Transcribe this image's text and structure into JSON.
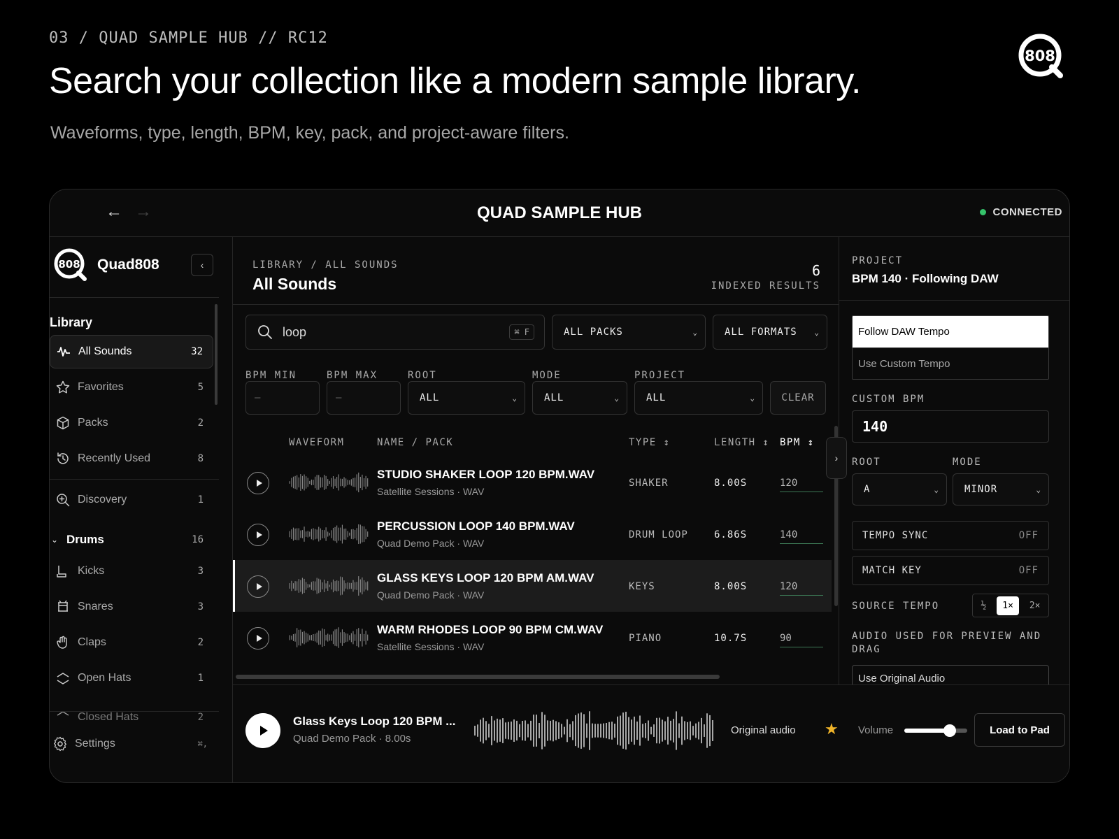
{
  "hero": {
    "eyebrow": "03 / QUAD SAMPLE HUB // RC12",
    "headline": "Search your collection like a modern sample library.",
    "subline": "Waveforms, type, length, BPM, key, pack, and project-aware filters.",
    "logo_text": "808"
  },
  "titlebar": {
    "title": "QUAD SAMPLE HUB",
    "back_icon": "←",
    "forward_icon": "→",
    "status": "CONNECTED",
    "status_color": "#36c36b"
  },
  "sidebar": {
    "brand": "Quad808",
    "logo_text": "808",
    "collapse_icon": "‹",
    "heading": "Library",
    "items": [
      {
        "label": "All Sounds",
        "count": "32",
        "icon": "waveform-icon"
      },
      {
        "label": "Favorites",
        "count": "5",
        "icon": "star-icon"
      },
      {
        "label": "Packs",
        "count": "2",
        "icon": "box-icon"
      },
      {
        "label": "Recently Used",
        "count": "8",
        "icon": "history-icon"
      },
      {
        "label": "Discovery",
        "count": "1",
        "icon": "zoom-icon"
      }
    ],
    "group": {
      "label": "Drums",
      "count": "16",
      "icon": "chevron-down-icon"
    },
    "drums": [
      {
        "label": "Kicks",
        "count": "3",
        "icon": "kick-icon"
      },
      {
        "label": "Snares",
        "count": "3",
        "icon": "snare-icon"
      },
      {
        "label": "Claps",
        "count": "2",
        "icon": "hand-icon"
      },
      {
        "label": "Open Hats",
        "count": "1",
        "icon": "open-hat-icon"
      },
      {
        "label": "Closed Hats",
        "count": "2",
        "icon": "closed-hat-icon"
      }
    ],
    "settings": {
      "label": "Settings",
      "shortcut": "⌘,",
      "icon": "gear-icon"
    }
  },
  "main": {
    "breadcrumb": "LIBRARY / ALL SOUNDS",
    "title": "All Sounds",
    "results_count": "6",
    "results_label": "INDEXED RESULTS",
    "search": {
      "value": "loop",
      "shortcut": "⌘ F"
    },
    "packs_select": "ALL PACKS",
    "formats_select": "ALL FORMATS",
    "filters": {
      "bpm_min_label": "BPM MIN",
      "bpm_min_placeholder": "—",
      "bpm_max_label": "BPM MAX",
      "bpm_max_placeholder": "—",
      "root_label": "ROOT",
      "root_value": "ALL",
      "mode_label": "MODE",
      "mode_value": "ALL",
      "project_label": "PROJECT",
      "project_value": "ALL",
      "clear_label": "CLEAR"
    },
    "columns": {
      "waveform": "WAVEFORM",
      "name": "NAME / PACK",
      "type": "TYPE ↕",
      "length": "LENGTH ↕",
      "bpm": "BPM ↕"
    },
    "rows": [
      {
        "name": "STUDIO SHAKER LOOP 120 BPM.WAV",
        "sub": "Satellite Sessions · WAV",
        "type": "SHAKER",
        "length": "8.00S",
        "bpm": "120",
        "selected": false
      },
      {
        "name": "PERCUSSION LOOP 140 BPM.WAV",
        "sub": "Quad Demo Pack · WAV",
        "type": "DRUM LOOP",
        "length": "6.86S",
        "bpm": "140",
        "selected": false
      },
      {
        "name": "GLASS KEYS LOOP 120 BPM AM.WAV",
        "sub": "Quad Demo Pack · WAV",
        "type": "KEYS",
        "length": "8.00S",
        "bpm": "120",
        "selected": true
      },
      {
        "name": "WARM RHODES LOOP 90 BPM CM.WAV",
        "sub": "Satellite Sessions · WAV",
        "type": "PIANO",
        "length": "10.7S",
        "bpm": "90",
        "selected": false
      }
    ]
  },
  "right": {
    "project_label": "PROJECT",
    "project_value": "BPM 140 · Following DAW",
    "follow_daw": "Follow DAW Tempo",
    "custom_tempo": "Use Custom Tempo",
    "custom_bpm_label": "CUSTOM BPM",
    "custom_bpm_value": "140",
    "root_label": "ROOT",
    "root_value": "A",
    "mode_label": "MODE",
    "mode_value": "MINOR",
    "tempo_sync": {
      "label": "TEMPO SYNC",
      "state": "OFF"
    },
    "match_key": {
      "label": "MATCH KEY",
      "state": "OFF"
    },
    "source_tempo_label": "SOURCE TEMPO",
    "speeds": [
      "½",
      "1×",
      "2×"
    ],
    "speed_selected": "1×",
    "audio_label": "AUDIO USED FOR PREVIEW AND DRAG",
    "audio_value": "Use Original Audio"
  },
  "player": {
    "name": "Glass Keys Loop 120 BPM ...",
    "sub": "Quad Demo Pack · 8.00s",
    "audio_mode": "Original audio",
    "star": "★",
    "volume_label": "Volume",
    "volume": 0.72,
    "load_label": "Load to Pad",
    "accent": "#f0b429"
  }
}
